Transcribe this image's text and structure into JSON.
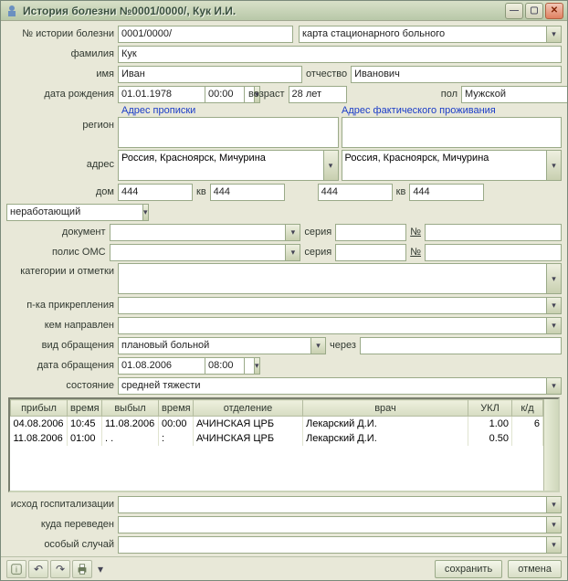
{
  "window": {
    "title": "История болезни №0001/0000/, Кук И.И."
  },
  "fields": {
    "history_no_label": "№ истории болезни",
    "history_no": "0001/0000/",
    "card_type": "карта стационарного больного",
    "surname_label": "фамилия",
    "surname": "Кук",
    "name_label": "имя",
    "name": "Иван",
    "patronymic_label": "отчество",
    "patronymic": "Иванович",
    "dob_label": "дата рождения",
    "dob": "01.01.1978",
    "dob_time": "00:00",
    "age_label": "возраст",
    "age": "28 лет",
    "sex_label": "пол",
    "sex": "Мужской",
    "reg_addr_link": "Адрес прописки",
    "fact_addr_link": "Адрес фактического проживания",
    "region_label": "регион",
    "region1": "",
    "region2": "",
    "address_label": "адрес",
    "address1": "Россия, Красноярск, Мичурина",
    "address2": "Россия, Красноярск, Мичурина",
    "house_label": "дом",
    "house1": "444",
    "flat_label": "кв",
    "flat1": "444",
    "house2": "444",
    "flat2": "444",
    "soc_status": "неработающий",
    "document_label": "документ",
    "series_label": "серия",
    "number_label": "№",
    "doc_value": "",
    "doc_series": "",
    "doc_no": "",
    "policy_label": "полис ОМС",
    "policy_value": "",
    "policy_series": "",
    "policy_no": "",
    "categories_label": "категории и отметки",
    "categories": "",
    "clinic_label": "п-ка прикрепления",
    "clinic": "",
    "referred_label": "кем направлен",
    "referred": "",
    "visit_type_label": "вид обращения",
    "visit_type": "плановый больной",
    "via_label": "через",
    "via": "",
    "visit_date_label": "дата обращения",
    "visit_date": "01.08.2006",
    "visit_time": "08:00",
    "condition_label": "состояние",
    "condition": "средней тяжести",
    "outcome_label": "исход госпитализации",
    "outcome": "",
    "transferred_label": "куда переведен",
    "transferred": "",
    "special_label": "особый случай",
    "special": ""
  },
  "grid": {
    "columns": [
      "прибыл",
      "время",
      "выбыл",
      "время",
      "отделение",
      "врач",
      "УКЛ",
      "к/д"
    ],
    "rows": [
      {
        "arrived": "04.08.2006",
        "atime": "10:45",
        "left": "11.08.2006",
        "ltime": "00:00",
        "dept": "АЧИНСКАЯ ЦРБ",
        "doctor": "Лекарский Д.И.",
        "ukl": "1.00",
        "kd": "6"
      },
      {
        "arrived": "11.08.2006",
        "atime": "01:00",
        "left": ".  .",
        "ltime": ":",
        "dept": "АЧИНСКАЯ ЦРБ",
        "doctor": "Лекарский Д.И.",
        "ukl": "0.50",
        "kd": ""
      }
    ]
  },
  "footer": {
    "save": "сохранить",
    "cancel": "отмена"
  }
}
